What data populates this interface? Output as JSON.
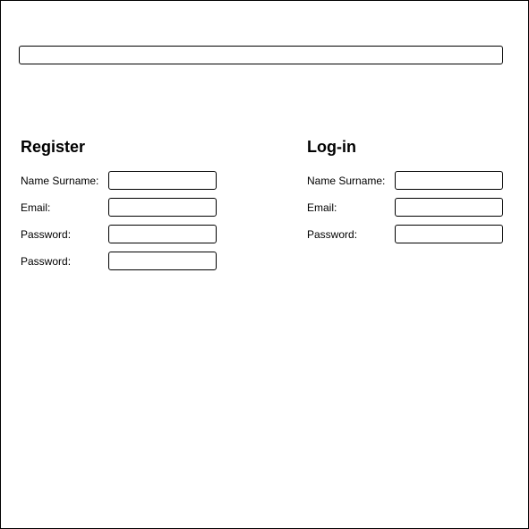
{
  "top_bar": {
    "value": ""
  },
  "register": {
    "title": "Register",
    "fields": [
      {
        "label": "Name Surname:",
        "value": ""
      },
      {
        "label": "Email:",
        "value": ""
      },
      {
        "label": "Password:",
        "value": ""
      },
      {
        "label": "Password:",
        "value": ""
      }
    ]
  },
  "login": {
    "title": "Log-in",
    "fields": [
      {
        "label": "Name Surname:",
        "value": ""
      },
      {
        "label": "Email:",
        "value": ""
      },
      {
        "label": "Password:",
        "value": ""
      }
    ]
  }
}
